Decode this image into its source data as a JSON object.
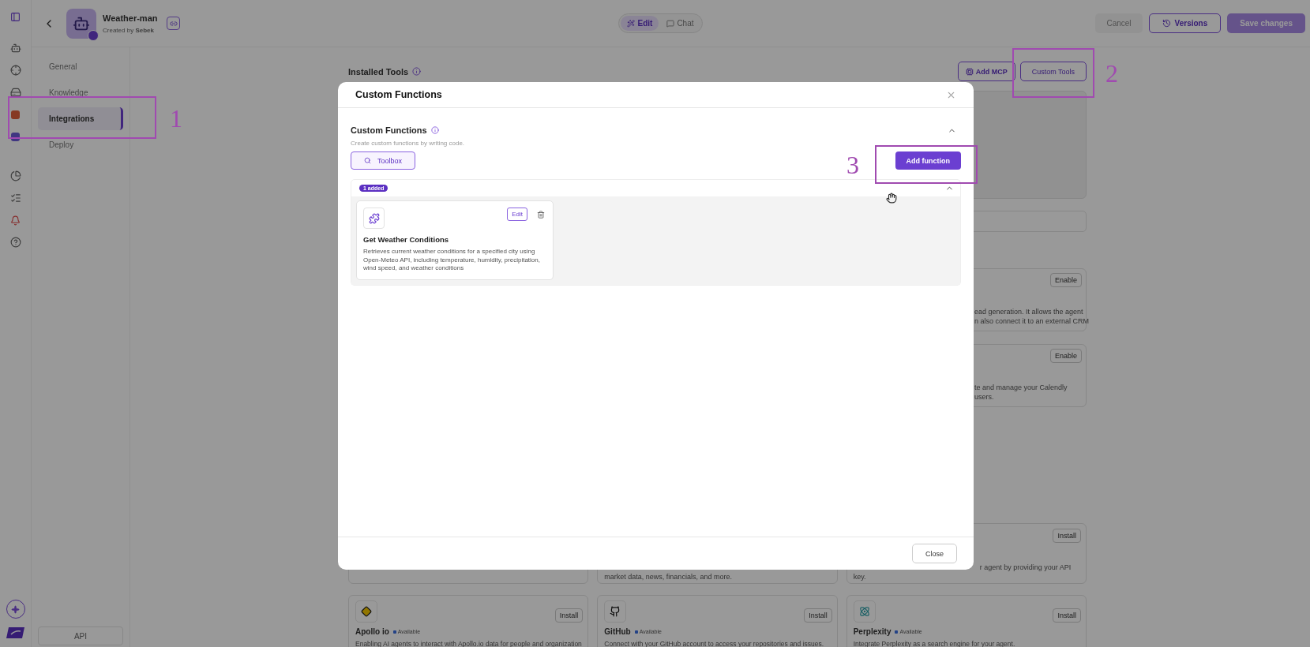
{
  "header": {
    "agent_name": "Weather-man",
    "created_by_label": "Created by",
    "creator": "Sebek"
  },
  "mode_toggle": [
    {
      "label": "Edit",
      "selected": true
    },
    {
      "label": "Chat",
      "selected": false
    }
  ],
  "actions": {
    "cancel": "Cancel",
    "versions": "Versions",
    "save": "Save changes",
    "save_disabled": true
  },
  "nav": {
    "items": [
      {
        "label": "General",
        "selected": false
      },
      {
        "label": "Knowledge",
        "selected": false
      },
      {
        "label": "Integrations",
        "selected": true
      },
      {
        "label": "Deploy",
        "selected": false
      }
    ],
    "api_button": "API"
  },
  "installed_tools": {
    "title": "Installed Tools",
    "add_mcp": "Add MCP",
    "custom_tools": "Custom Tools"
  },
  "tool_cards": [
    {
      "button": "Enable",
      "lines": [
        "ead generation. It allows the agent",
        "n also connect it to an external CRM"
      ]
    },
    {
      "button": "Enable",
      "lines": [
        "te and manage your Calendly",
        "users."
      ]
    }
  ],
  "integration_partial_row": [
    {
      "lines": [
        "market data, news, financials, and more."
      ]
    },
    {
      "button": "Install",
      "lines": [
        "r agent by providing your API",
        "key."
      ]
    }
  ],
  "integrations": [
    {
      "name": "Apollo io",
      "status": "Available",
      "description": "Enabling AI agents to interact with Apollo.io data for people and organization",
      "button": "Install",
      "kind": "apollo"
    },
    {
      "name": "GitHub",
      "status": "Available",
      "description": "Connect with your GitHub account to access your repositories and issues.",
      "button": "Install",
      "kind": "github"
    },
    {
      "name": "Perplexity",
      "status": "Available",
      "description": "Integrate Perplexity as a search engine for your agent.",
      "button": "Install",
      "kind": "perplexity"
    }
  ],
  "modal": {
    "title": "Custom Functions",
    "section_title": "Custom Functions",
    "section_subtitle": "Create custom functions by writing code.",
    "expanded": true,
    "toolbox": "Toolbox",
    "add_function": "Add function",
    "list": {
      "badge": "1 added",
      "expanded": true,
      "functions": [
        {
          "name": "Get Weather Conditions",
          "description": "Retrieves current weather conditions for a specified city using Open-Meteo API, including temperature, humidity, precipitation, wind speed, and weather conditions",
          "edit": "Edit"
        }
      ]
    },
    "close": "Close"
  },
  "annotations": [
    {
      "label": "1"
    },
    {
      "label": "2"
    },
    {
      "label": "3"
    }
  ]
}
